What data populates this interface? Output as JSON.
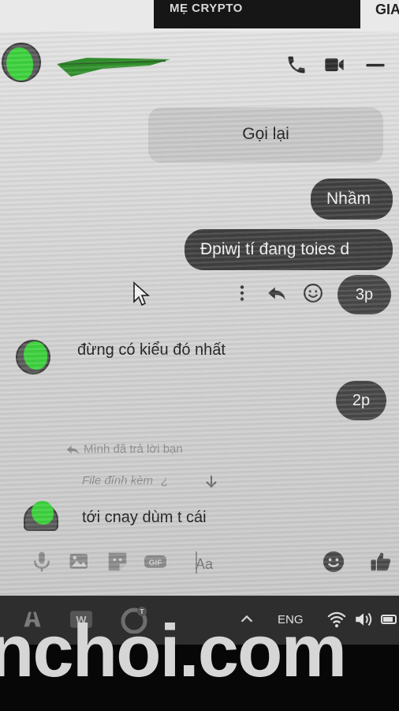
{
  "background": {
    "top_banner": "MẸ CRYPTO",
    "top_right_fragment": "GIA"
  },
  "header": {
    "contact_name": "",
    "icons": [
      "phone-icon",
      "video-call-icon",
      "minimize-icon"
    ]
  },
  "messages": {
    "recalled_banner": "Gọi lại",
    "outgoing_1": "Nhầm",
    "outgoing_2": "Đpiwj tí đang toies d",
    "time_1": "3p",
    "incoming_1": "đừng có kiểu đó nhất",
    "time_2": "2p",
    "reply_note": "Mình đã trả lời bạn",
    "attachment_label": "File đính kèm",
    "incoming_2": "tới cnay dùm t cái"
  },
  "composer": {
    "placeholder": "Aa",
    "icons": [
      "microphone-icon",
      "photo-icon",
      "sticker-icon",
      "gif-icon",
      "emoji-icon",
      "like-icon"
    ]
  },
  "taskbar": {
    "language": "ENG"
  },
  "watermark": "nchoi.com",
  "colors": {
    "outgoing_bubble": "#3f3f3f",
    "avatar_green": "#3dd13d",
    "redaction_green": "#2f8f2a"
  }
}
